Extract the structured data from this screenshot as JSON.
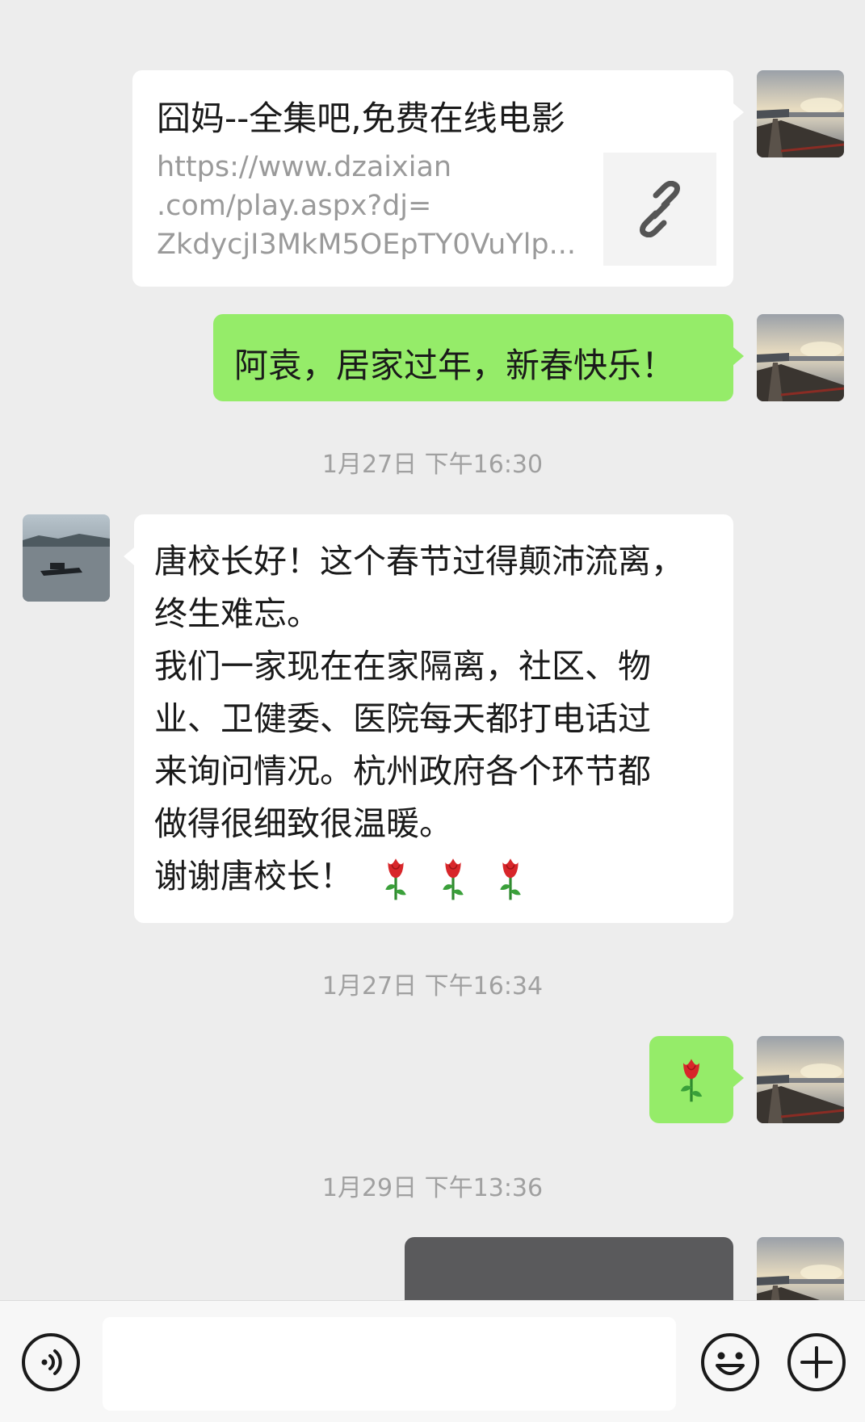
{
  "messages": {
    "link_card": {
      "title": "囧妈--全集吧,免费在线电影",
      "url_line1": "https://www.dzaixian",
      "url_line2": ".com/play.aspx?dj=",
      "url_line3": "ZkdycjI3MkM5OEpTY0VuYlp..."
    },
    "greeting": "阿袁，居家过年，新春快乐！",
    "time1": "1月27日 下午16:30",
    "reply_lines": [
      "唐校长好！这个春节过得颠沛流离，",
      "终生难忘。",
      "我们一家现在在家隔离，社区、物",
      "业、卫健委、医院每天都打电话过",
      "来询问情况。杭州政府各个环节都",
      "做得很细致很温暖。",
      "谢谢唐校长！"
    ],
    "time2": "1月27日 下午16:34",
    "time3": "1月29日 下午13:36"
  },
  "icons": {
    "link": "link-icon",
    "rose": "rose-icon",
    "voice": "voice-icon",
    "emoji": "emoji-icon",
    "plus": "plus-icon"
  },
  "colors": {
    "background": "#ededed",
    "bubble_green": "#95ec69",
    "bubble_white": "#ffffff",
    "timestamp": "#a0a0a0"
  }
}
